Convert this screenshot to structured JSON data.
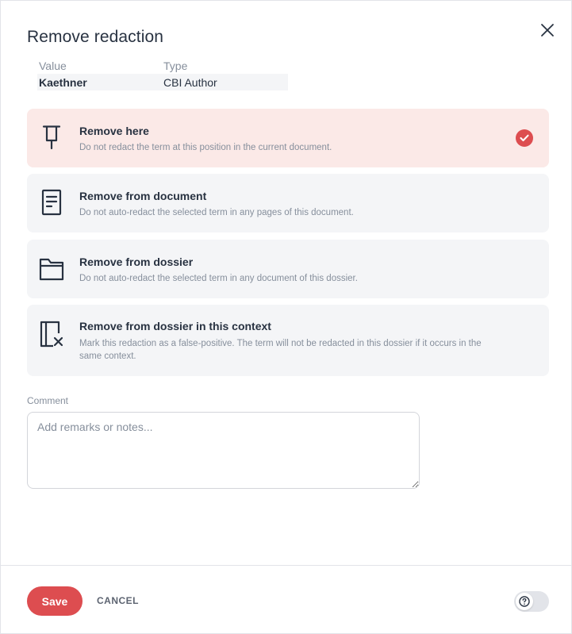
{
  "dialog": {
    "title": "Remove redaction",
    "close_icon": "close-icon"
  },
  "value_table": {
    "headers": [
      "Value",
      "Type"
    ],
    "row": {
      "value": "Kaethner",
      "type": "CBI Author"
    }
  },
  "options": [
    {
      "title": "Remove here",
      "description": "Do not redact the term at this position in the current document.",
      "icon": "pin-icon",
      "selected": true
    },
    {
      "title": "Remove from document",
      "description": "Do not auto-redact the selected term in any pages of this document.",
      "icon": "document-icon",
      "selected": false
    },
    {
      "title": "Remove from dossier",
      "description": "Do not auto-redact the selected term in any document of this dossier.",
      "icon": "folder-icon",
      "selected": false
    },
    {
      "title": "Remove from dossier in this context",
      "description": "Mark this redaction as a false-positive. The term will not be redacted in this dossier if it occurs in the same context.",
      "icon": "false-positive-icon",
      "selected": false
    }
  ],
  "comment": {
    "label": "Comment",
    "placeholder": "Add remarks or notes...",
    "value": ""
  },
  "footer": {
    "save_label": "Save",
    "cancel_label": "CANCEL",
    "help_icon": "help-icon"
  },
  "colors": {
    "accent": "#dd4d50",
    "selected_bg": "#fbe9e7",
    "option_bg": "#f4f5f7",
    "text": "#283241",
    "muted": "#868f9c"
  }
}
